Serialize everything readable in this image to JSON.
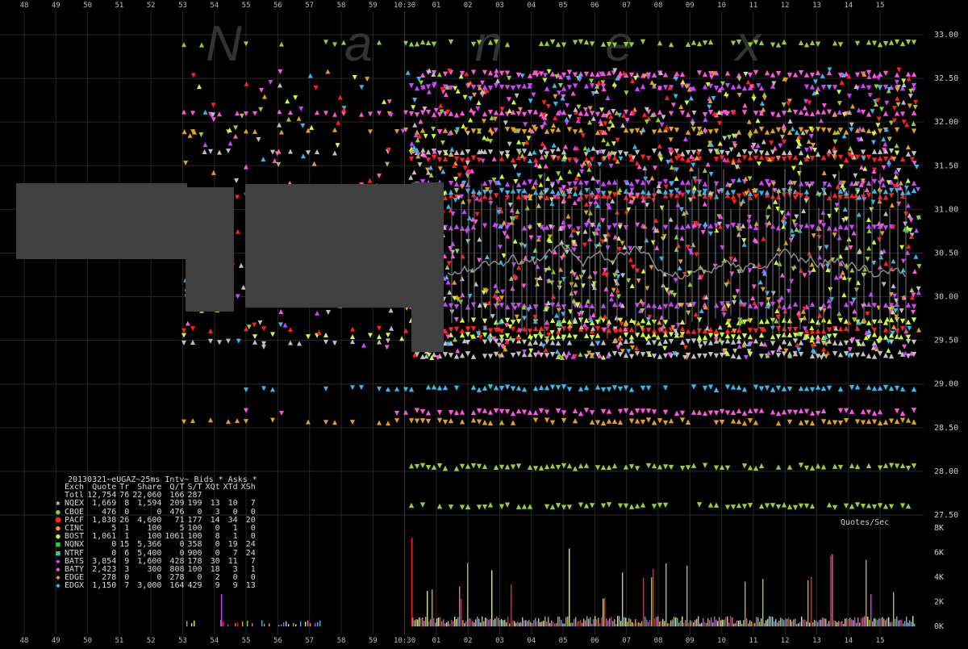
{
  "watermark": "N a n e x",
  "header": {
    "title": "20130321~eUGAZ~25ms Intv~ Bids * Asks *"
  },
  "stats": {
    "columns": [
      "Exch",
      "Quote",
      "Tr",
      "Share",
      "Q/T",
      "S/T",
      "XQt",
      "XTd",
      "XSh"
    ],
    "rows": [
      {
        "exch": "Totl",
        "quote": "12,754",
        "tr": "76",
        "share": "22,060",
        "qt": "166",
        "st": "287",
        "xqt": "",
        "xtd": "",
        "xsh": "",
        "color": "",
        "shape": ""
      },
      {
        "exch": "NQEX",
        "quote": "1,669",
        "tr": "8",
        "share": "1,594",
        "qt": "209",
        "st": "199",
        "xqt": "13",
        "xtd": "10",
        "xsh": "7",
        "color": "#c0c0c0",
        "shape": "gear"
      },
      {
        "exch": "CBOE",
        "quote": "476",
        "tr": "0",
        "share": "0",
        "qt": "476",
        "st": "0",
        "xqt": "3",
        "xtd": "0",
        "xsh": "0",
        "color": "#9acd32",
        "shape": "dot"
      },
      {
        "exch": "PACF",
        "quote": "1,838",
        "tr": "26",
        "share": "4,600",
        "qt": "71",
        "st": "177",
        "xqt": "14",
        "xtd": "34",
        "xsh": "20",
        "color": "#ff2020",
        "shape": "octagon"
      },
      {
        "exch": "CINC",
        "quote": "5",
        "tr": "1",
        "share": "100",
        "qt": "5",
        "st": "100",
        "xqt": "0",
        "xtd": "1",
        "xsh": "0",
        "color": "#ff9040",
        "shape": "dot"
      },
      {
        "exch": "BOST",
        "quote": "1,061",
        "tr": "1",
        "share": "100",
        "qt": "1061",
        "st": "100",
        "xqt": "8",
        "xtd": "1",
        "xsh": "0",
        "color": "#ccff33",
        "shape": "dot"
      },
      {
        "exch": "NQNX",
        "quote": "0",
        "tr": "15",
        "share": "5,366",
        "qt": "0",
        "st": "358",
        "xqt": "0",
        "xtd": "19",
        "xsh": "24",
        "color": "#33cc33",
        "shape": "square"
      },
      {
        "exch": "NTRF",
        "quote": "0",
        "tr": "6",
        "share": "5,400",
        "qt": "0",
        "st": "900",
        "xqt": "0",
        "xtd": "7",
        "xsh": "24",
        "color": "#33cc99",
        "shape": "square"
      },
      {
        "exch": "BATS",
        "quote": "3,854",
        "tr": "9",
        "share": "1,600",
        "qt": "428",
        "st": "178",
        "xqt": "30",
        "xtd": "11",
        "xsh": "7",
        "color": "#cc44ff",
        "shape": "diamond"
      },
      {
        "exch": "BATY",
        "quote": "2,423",
        "tr": "3",
        "share": "300",
        "qt": "808",
        "st": "100",
        "xqt": "18",
        "xtd": "3",
        "xsh": "1",
        "color": "#ff55dd",
        "shape": "diamond"
      },
      {
        "exch": "EDGE",
        "quote": "278",
        "tr": "0",
        "share": "0",
        "qt": "278",
        "st": "0",
        "xqt": "2",
        "xtd": "0",
        "xsh": "0",
        "color": "#e0a020",
        "shape": "diamond"
      },
      {
        "exch": "EDGX",
        "quote": "1,150",
        "tr": "7",
        "share": "3,000",
        "qt": "164",
        "st": "429",
        "xqt": "9",
        "xtd": "9",
        "xsh": "13",
        "color": "#33bbee",
        "shape": "diamond"
      }
    ]
  },
  "chart_data": {
    "type": "scatter",
    "title": "20130321~eUGAZ~25ms Intv~ Bids * Asks *",
    "x_ticks_top": [
      "48",
      "49",
      "50",
      "51",
      "52",
      "53",
      "54",
      "55",
      "56",
      "57",
      "58",
      "59",
      "10:30",
      "01",
      "02",
      "03",
      "04",
      "05",
      "06",
      "07",
      "08",
      "09",
      "10",
      "11",
      "12",
      "13",
      "14",
      "15"
    ],
    "x_ticks_bottom": [
      "48",
      "49",
      "50",
      "51",
      "52",
      "53",
      "54",
      "55",
      "56",
      "57",
      "58",
      "59",
      "10:30",
      "01",
      "02",
      "03",
      "04",
      "05",
      "06",
      "07",
      "08",
      "09",
      "10",
      "11",
      "12",
      "13",
      "14",
      "15"
    ],
    "y_ticks": [
      "33.00",
      "32.50",
      "32.00",
      "31.50",
      "31.00",
      "30.50",
      "30.00",
      "29.50",
      "29.00",
      "28.50",
      "28.00",
      "27.50"
    ],
    "ylim": [
      27.5,
      33.0
    ],
    "grid": true,
    "series": [
      {
        "name": "NQEX",
        "color": "#c0c0c0",
        "levels": [
          31.65,
          29.33,
          29.48
        ]
      },
      {
        "name": "CBOE",
        "color": "#9acd32",
        "levels": [
          32.9,
          27.6,
          28.05
        ]
      },
      {
        "name": "PACF",
        "color": "#ff2020",
        "levels": [
          31.58,
          29.62,
          31.15
        ]
      },
      {
        "name": "BOST",
        "color": "#ccff33",
        "levels": [
          29.55,
          29.72
        ]
      },
      {
        "name": "BATS",
        "color": "#cc44ff",
        "levels": [
          32.4,
          31.3,
          30.8,
          29.9
        ]
      },
      {
        "name": "BATY",
        "color": "#ff55dd",
        "levels": [
          32.55,
          32.1,
          28.68
        ]
      },
      {
        "name": "EDGE",
        "color": "#e0a020",
        "levels": [
          28.57,
          31.9
        ]
      },
      {
        "name": "EDGX",
        "color": "#33bbee",
        "levels": [
          28.95,
          31.2
        ]
      }
    ],
    "quotes_panel": {
      "label": "Quotes/Sec",
      "y_ticks": [
        "8K",
        "6K",
        "4K",
        "2K",
        "0K"
      ],
      "ylim": [
        0,
        8000
      ]
    }
  }
}
